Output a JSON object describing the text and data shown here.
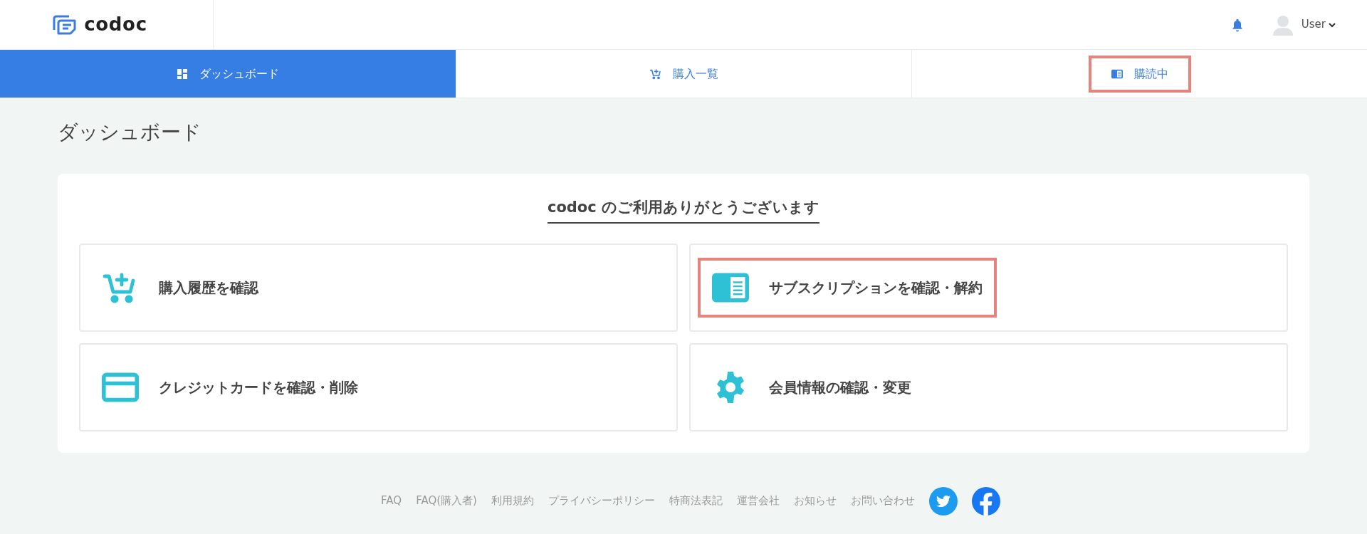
{
  "header": {
    "logo": "codoc",
    "user": "User"
  },
  "tabs": [
    {
      "label": "ダッシュボード",
      "kind": "dashboard",
      "selected": true,
      "highlighted": false
    },
    {
      "label": "購入一覧",
      "kind": "cart",
      "selected": false,
      "highlighted": false
    },
    {
      "label": "購読中",
      "kind": "subscription",
      "selected": false,
      "highlighted": true
    }
  ],
  "page_title": "ダッシュボード",
  "panel": {
    "heading": "codoc のご利用ありがとうございます",
    "cards": [
      {
        "label": "購入履歴を確認",
        "kind": "cart",
        "highlighted": false
      },
      {
        "label": "サブスクリプションを確認・解約",
        "kind": "subscription",
        "highlighted": true
      },
      {
        "label": "クレジットカードを確認・削除",
        "kind": "card",
        "highlighted": false
      },
      {
        "label": "会員情報の確認・変更",
        "kind": "gear",
        "highlighted": false
      }
    ]
  },
  "footer": {
    "links": [
      "FAQ",
      "FAQ(購入者)",
      "利用規約",
      "プライバシーポリシー",
      "特商法表記",
      "運営会社",
      "お知らせ",
      "お問い合わせ"
    ]
  }
}
